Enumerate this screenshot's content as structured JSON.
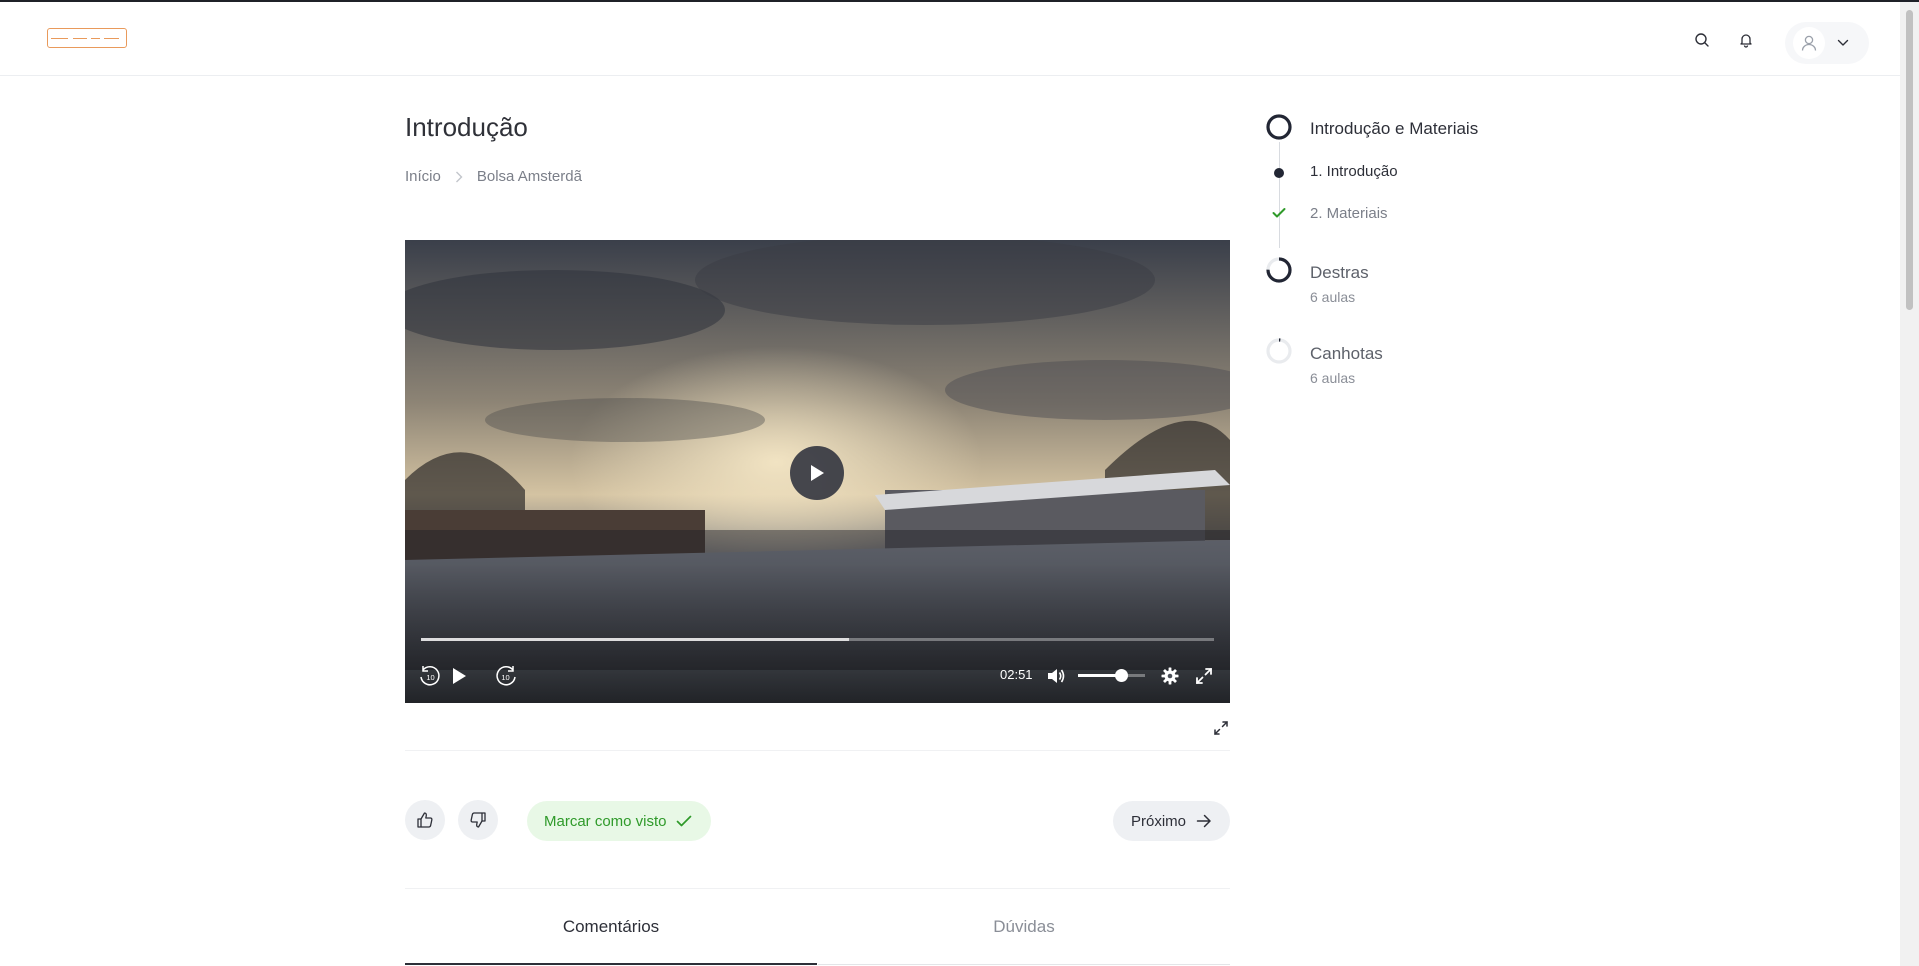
{
  "header": {
    "search_icon": "search-icon",
    "bell_icon": "bell-icon",
    "user_icon": "user-icon",
    "chevron_icon": "chevron-down-icon"
  },
  "page": {
    "title": "Introdução",
    "breadcrumb": [
      "Início",
      "Bolsa Amsterdã"
    ]
  },
  "player": {
    "time": "02:51",
    "progress": 0.54,
    "volume": 0.64,
    "controls": [
      "rewind-10-icon",
      "play-icon",
      "forward-10-icon",
      "volume-icon",
      "settings-icon",
      "fullscreen-icon"
    ]
  },
  "actions": {
    "mark_seen": "Marcar como visto",
    "next": "Próximo"
  },
  "tabs": [
    {
      "label": "Comentários",
      "active": true
    },
    {
      "label": "Dúvidas",
      "active": false
    }
  ],
  "sidebar": {
    "modules": [
      {
        "title": "Introdução e Materiais",
        "lessons": [
          {
            "label": "1. Introdução",
            "state": "current"
          },
          {
            "label": "2. Materiais",
            "state": "done"
          }
        ]
      },
      {
        "title": "Destras",
        "subtitle": "6 aulas",
        "progress": 0.75
      },
      {
        "title": "Canhotas",
        "subtitle": "6 aulas",
        "progress": 0.02
      }
    ]
  },
  "colors": {
    "accent_green": "#2f9a2a",
    "dark": "#2d2f38",
    "logo": "#e99a5b"
  }
}
